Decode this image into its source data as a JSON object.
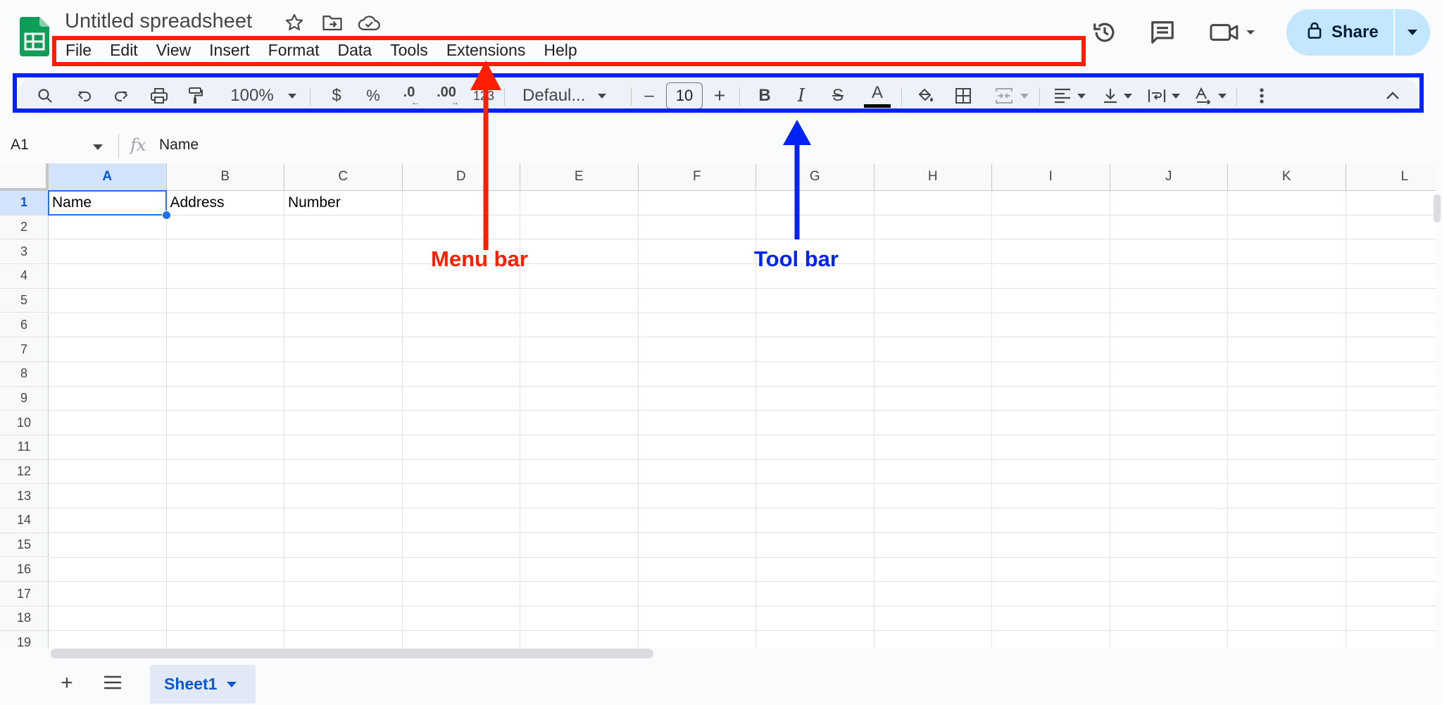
{
  "app": {
    "doc_title": "Untitled spreadsheet"
  },
  "header": {
    "share_label": "Share",
    "icons": [
      "star-icon",
      "move-to-folder-icon",
      "cloud-status-icon",
      "version-history-icon",
      "comment-icon",
      "meet-video-icon",
      "lock-icon"
    ]
  },
  "menu": {
    "items": [
      "File",
      "Edit",
      "View",
      "Insert",
      "Format",
      "Data",
      "Tools",
      "Extensions",
      "Help"
    ]
  },
  "toolbar": {
    "zoom": "100%",
    "currency": "$",
    "percent": "%",
    "dec_decrease": ".0",
    "dec_increase": ".00",
    "more_formats": "123",
    "font_name": "Defaul...",
    "font_size": "10",
    "minus": "–",
    "plus": "+",
    "bold": "B",
    "italic": "I",
    "strike": "S",
    "text_color": "A",
    "text_color_bar": "#000000"
  },
  "annotations": {
    "menu_bar_label": "Menu bar",
    "tool_bar_label": "Tool bar",
    "menu_color": "#ff1e00",
    "tool_color": "#0023f5"
  },
  "formula_bar": {
    "name_box": "A1",
    "fx": "fx",
    "content": "Name"
  },
  "grid": {
    "columns": [
      "A",
      "B",
      "C",
      "D",
      "E",
      "F",
      "G",
      "H",
      "I",
      "J",
      "K",
      "L"
    ],
    "rows": [
      "1",
      "2",
      "3",
      "4",
      "5",
      "6",
      "7",
      "8",
      "9",
      "10",
      "11",
      "12",
      "13",
      "14",
      "15",
      "16",
      "17",
      "18",
      "19"
    ],
    "selected_cell": "A1",
    "cells": {
      "A1": "Name",
      "B1": "Address",
      "C1": "Number"
    }
  },
  "sheets": {
    "tabs": [
      "Sheet1"
    ]
  }
}
